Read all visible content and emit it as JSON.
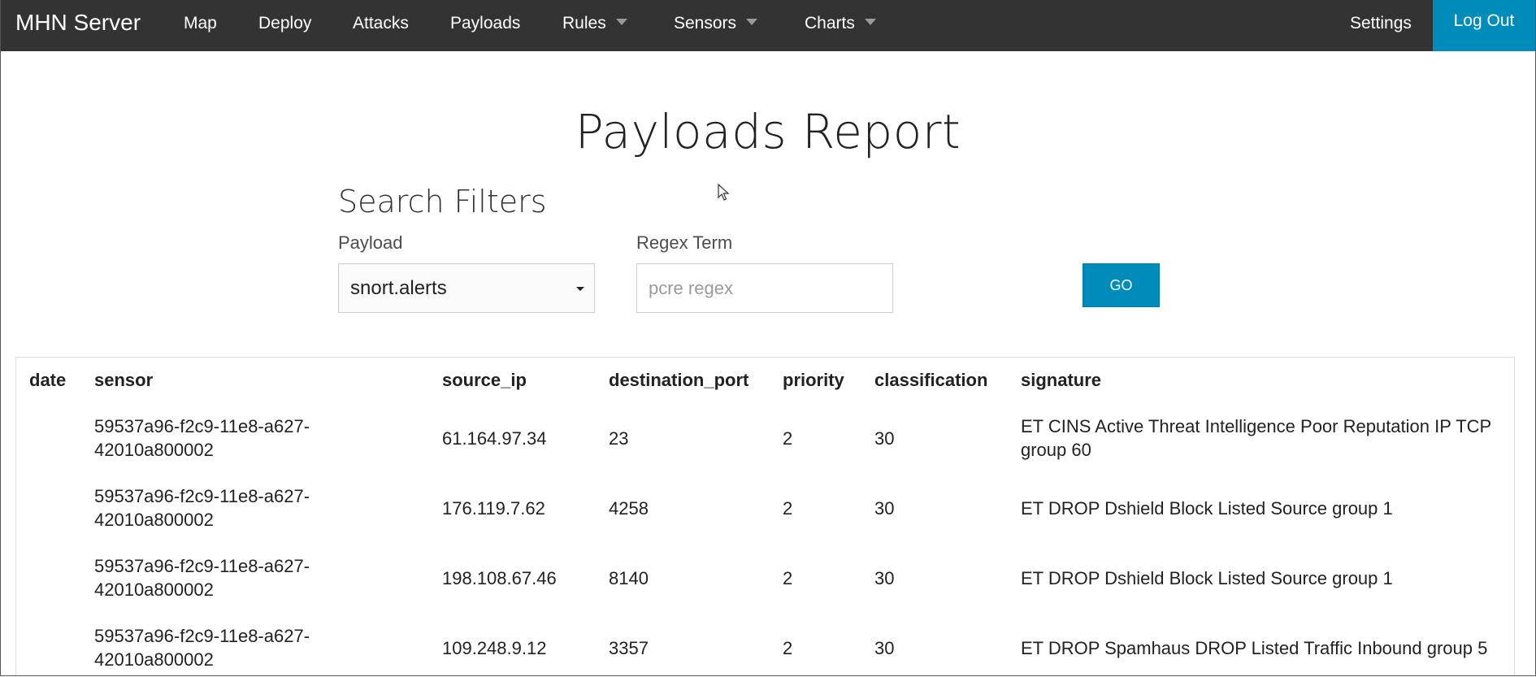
{
  "nav": {
    "brand": "MHN Server",
    "items": [
      {
        "label": "Map",
        "dropdown": false
      },
      {
        "label": "Deploy",
        "dropdown": false
      },
      {
        "label": "Attacks",
        "dropdown": false
      },
      {
        "label": "Payloads",
        "dropdown": false
      },
      {
        "label": "Rules",
        "dropdown": true
      },
      {
        "label": "Sensors",
        "dropdown": true
      },
      {
        "label": "Charts",
        "dropdown": true
      }
    ],
    "settings": "Settings",
    "logout": "Log Out"
  },
  "page": {
    "title": "Payloads Report"
  },
  "filters": {
    "heading": "Search Filters",
    "payload_label": "Payload",
    "payload_value": "snort.alerts",
    "regex_label": "Regex Term",
    "regex_value": "",
    "regex_placeholder": "pcre regex",
    "go_label": "GO"
  },
  "colors": {
    "topbar": "#333333",
    "accent": "#008cba"
  },
  "table": {
    "columns": [
      "date",
      "sensor",
      "source_ip",
      "destination_port",
      "priority",
      "classification",
      "signature"
    ],
    "rows": [
      {
        "date": "",
        "sensor": "59537a96-f2c9-11e8-a627-42010a800002",
        "source_ip": "61.164.97.34",
        "destination_port": "23",
        "priority": "2",
        "classification": "30",
        "signature": "ET CINS Active Threat Intelligence Poor Reputation IP TCP group 60"
      },
      {
        "date": "",
        "sensor": "59537a96-f2c9-11e8-a627-42010a800002",
        "source_ip": "176.119.7.62",
        "destination_port": "4258",
        "priority": "2",
        "classification": "30",
        "signature": "ET DROP Dshield Block Listed Source group 1"
      },
      {
        "date": "",
        "sensor": "59537a96-f2c9-11e8-a627-42010a800002",
        "source_ip": "198.108.67.46",
        "destination_port": "8140",
        "priority": "2",
        "classification": "30",
        "signature": "ET DROP Dshield Block Listed Source group 1"
      },
      {
        "date": "",
        "sensor": "59537a96-f2c9-11e8-a627-42010a800002",
        "source_ip": "109.248.9.12",
        "destination_port": "3357",
        "priority": "2",
        "classification": "30",
        "signature": "ET DROP Spamhaus DROP Listed Traffic Inbound group 5"
      }
    ]
  }
}
